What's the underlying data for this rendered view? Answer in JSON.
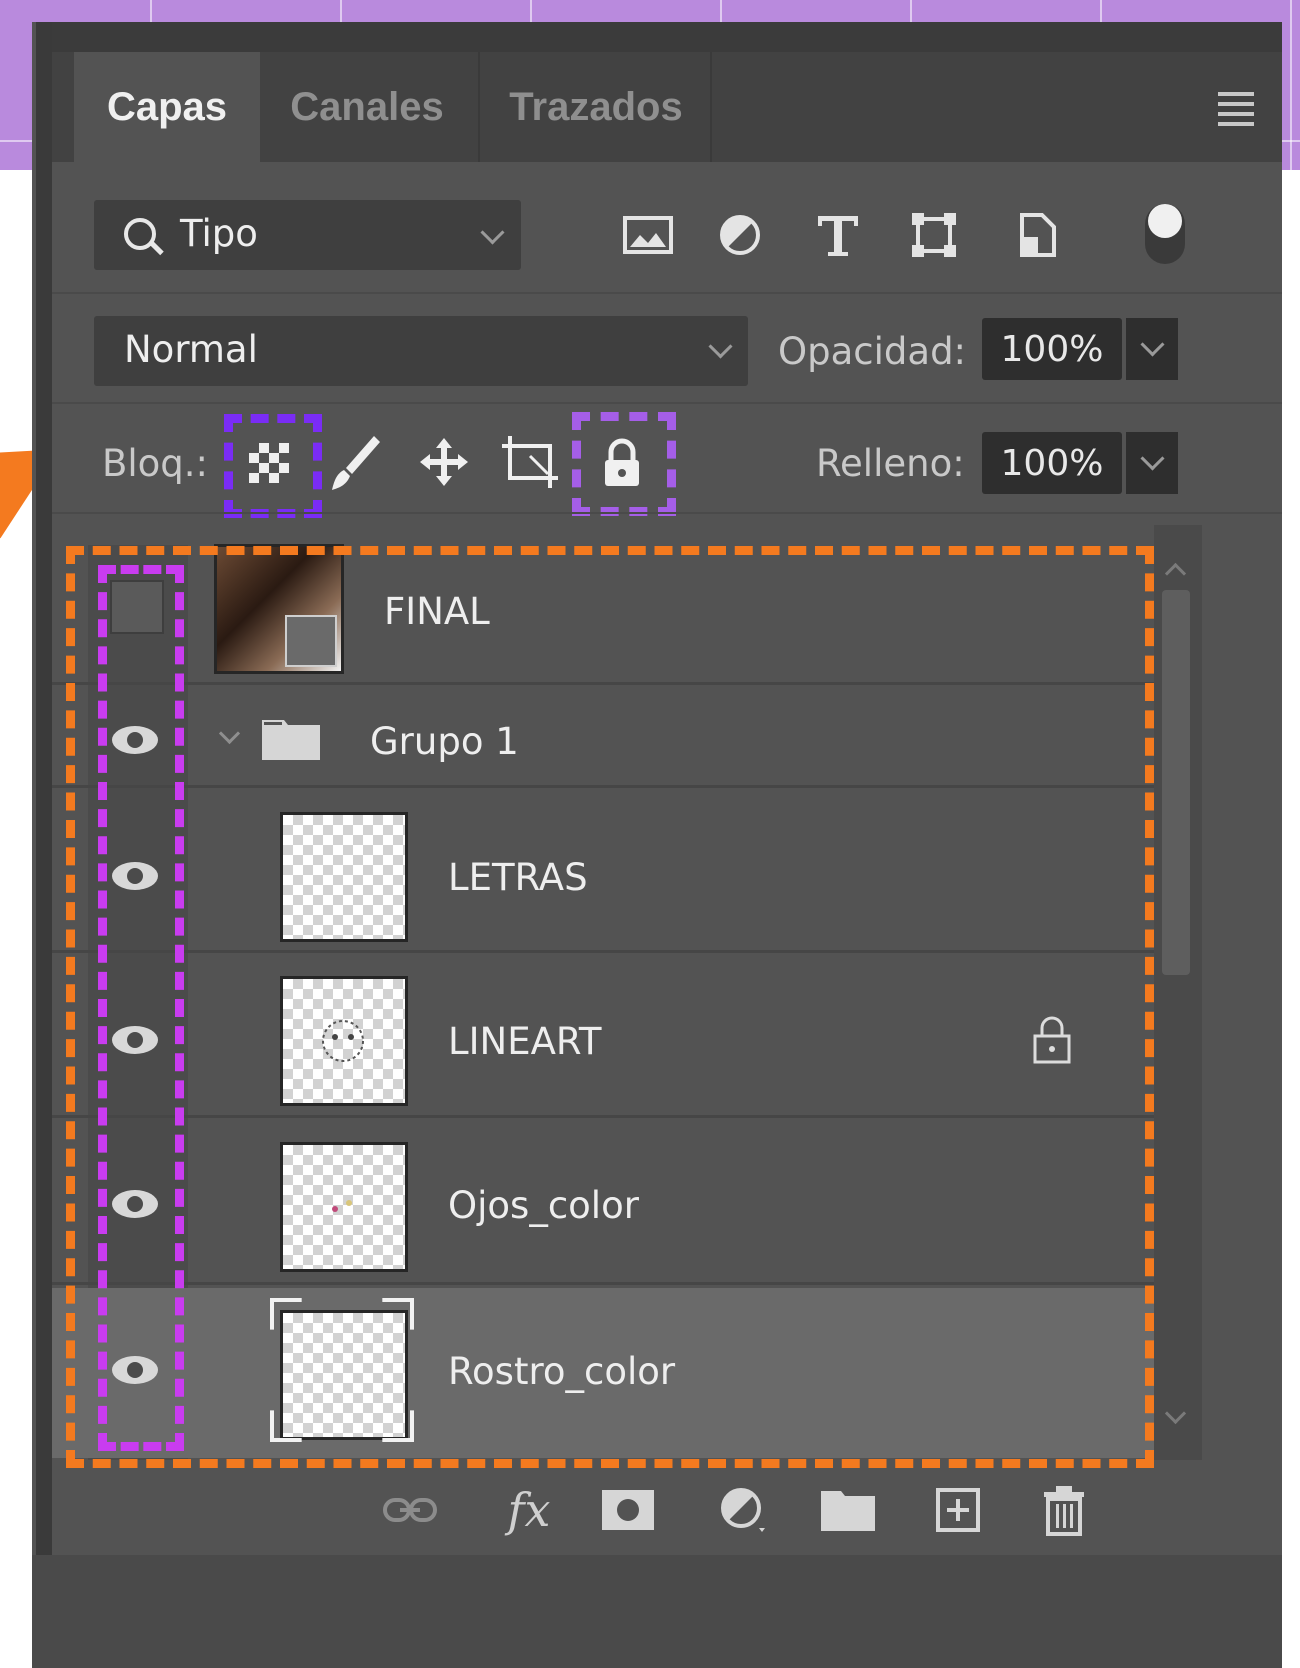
{
  "tabs": [
    {
      "label": "Capas",
      "active": true
    },
    {
      "label": "Canales",
      "active": false
    },
    {
      "label": "Trazados",
      "active": false
    }
  ],
  "filter": {
    "search_value": "Tipo",
    "icons": [
      "image-filter-icon",
      "adjustment-filter-icon",
      "type-filter-icon",
      "shape-filter-icon",
      "smart-object-filter-icon"
    ]
  },
  "blend": {
    "mode": "Normal",
    "opacity_label": "Opacidad:",
    "opacity_value": "100%"
  },
  "lock": {
    "label": "Bloq.:",
    "fill_label": "Relleno:",
    "fill_value": "100%"
  },
  "layers": [
    {
      "name": "FINAL",
      "visible": false,
      "type": "smart-object"
    },
    {
      "name": "Grupo 1",
      "visible": true,
      "type": "group",
      "expanded": true
    },
    {
      "name": "LETRAS",
      "visible": true,
      "type": "pixel"
    },
    {
      "name": "LINEART",
      "visible": true,
      "type": "pixel",
      "locked": true
    },
    {
      "name": "Ojos_color",
      "visible": true,
      "type": "pixel"
    },
    {
      "name": "Rostro_color",
      "visible": true,
      "type": "pixel",
      "selected": true
    }
  ],
  "colors": {
    "panel": "#535353",
    "highlight_orange": "#f47a1f",
    "highlight_magenta": "#c93cf0",
    "highlight_violet": "#7a2cf5",
    "highlight_lavender": "#a55ee8",
    "background_purple": "#b98add"
  }
}
